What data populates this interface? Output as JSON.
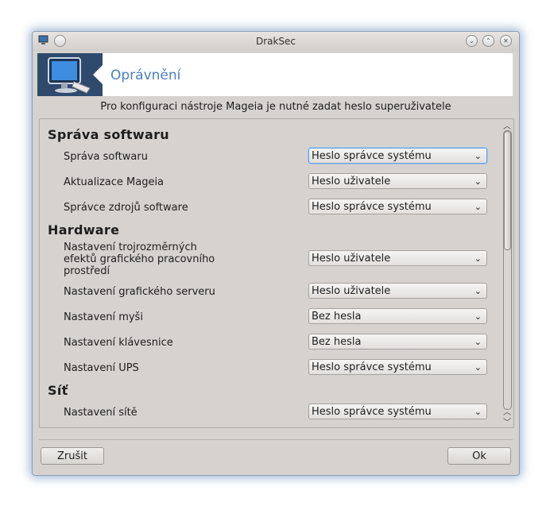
{
  "window": {
    "title": "DrakSec"
  },
  "banner": {
    "title": "Oprávnění"
  },
  "info_text": "Pro konfiguraci nástroje Mageia je nutné zadat heslo superuživatele",
  "sections": [
    {
      "title": "Správa softwaru",
      "rows": [
        {
          "label": "Správa softwaru",
          "value": "Heslo správce systému"
        },
        {
          "label": "Aktualizace Mageia",
          "value": "Heslo uživatele"
        },
        {
          "label": "Správce zdrojů software",
          "value": "Heslo správce systému"
        }
      ]
    },
    {
      "title": "Hardware",
      "rows": [
        {
          "label": "Nastavení trojrozměrných\nefektů grafického pracovního\nprostředí",
          "value": "Heslo uživatele"
        },
        {
          "label": "Nastavení grafického serveru",
          "value": "Heslo uživatele"
        },
        {
          "label": "Nastavení myši",
          "value": "Bez hesla"
        },
        {
          "label": "Nastavení klávesnice",
          "value": "Bez hesla"
        },
        {
          "label": "Nastavení UPS",
          "value": "Heslo správce systému"
        }
      ]
    },
    {
      "title": "Síť",
      "rows": [
        {
          "label": "Nastavení sítě",
          "value": "Heslo správce systému"
        }
      ]
    }
  ],
  "buttons": {
    "cancel": "Zrušit",
    "ok": "Ok"
  },
  "icons": {
    "caret": "chevron-down-icon",
    "window_minimize": "minimize-icon",
    "window_maximize": "maximize-icon",
    "window_close": "close-icon"
  }
}
